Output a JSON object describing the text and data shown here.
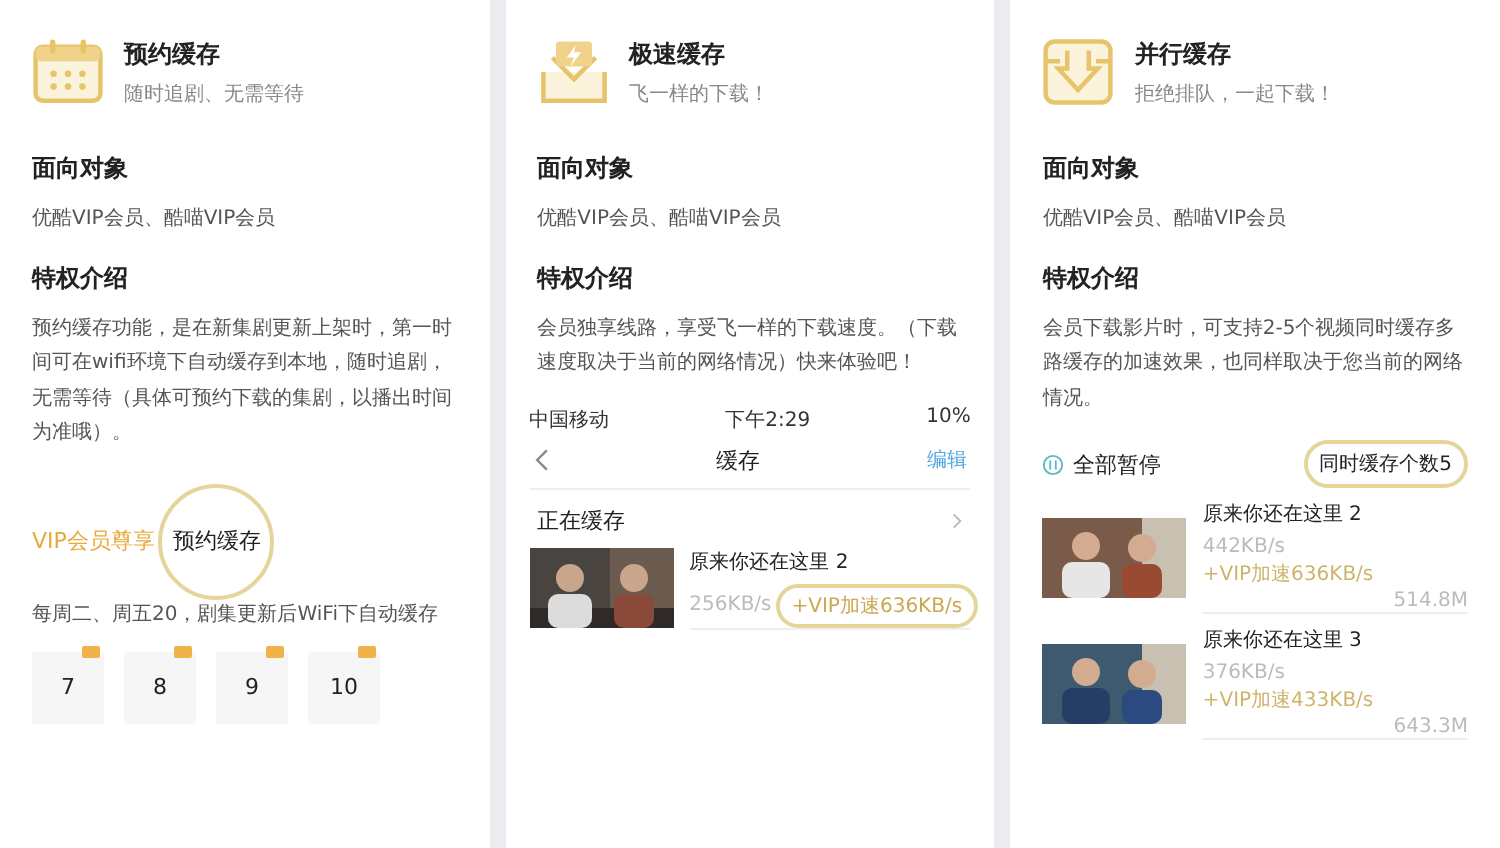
{
  "cards": [
    {
      "kind": "schedule",
      "title": "预约缓存",
      "subtitle": "随时追剧、无需等待",
      "audience_heading": "面向对象",
      "audience": "优酷VIP会员、酷喵VIP会员",
      "intro_heading": "特权介绍",
      "intro": "预约缓存功能，是在新集剧更新上架时，第一时间可在wifi环境下自动缓存到本地，随时追剧，无需等待（具体可预约下载的集剧，以播出时间为准哦）。",
      "demo": {
        "headline": "VIP会员尊享",
        "magnifier": "预约缓存",
        "schedule_start": "每周二、周五20",
        "schedule_end": "，剧集更新后WiFi下自动缓存",
        "episodes": [
          "7",
          "8",
          "9",
          "10"
        ]
      }
    },
    {
      "kind": "speed",
      "title": "极速缓存",
      "subtitle": "飞一样的下载！",
      "audience_heading": "面向对象",
      "audience": "优酷VIP会员、酷喵VIP会员",
      "intro_heading": "特权介绍",
      "intro": "会员独享线路，享受飞一样的下载速度。（下载速度取决于当前的网络情况）快来体验吧！",
      "demo": {
        "carrier": "中国移动",
        "time": "下午2:29",
        "battery": "10%",
        "nav_title": "缓存",
        "nav_action": "编辑",
        "section": "正在缓存",
        "item": {
          "title": "原来你还在这里 2",
          "speed": "256KB/s",
          "boost": "+VIP加速636KB/s"
        }
      }
    },
    {
      "kind": "parallel",
      "title": "并行缓存",
      "subtitle": "拒绝排队，一起下载！",
      "audience_heading": "面向对象",
      "audience": "优酷VIP会员、酷喵VIP会员",
      "intro_heading": "特权介绍",
      "intro": "会员下载影片时，可支持2-5个视频同时缓存多路缓存的加速效果，也同样取决于您当前的网络情况。",
      "demo": {
        "pause_all": "全部暂停",
        "concurrency": "同时缓存个数5",
        "items": [
          {
            "title": "原来你还在这里 2",
            "speed": "442KB/s",
            "boost": "+VIP加速636KB/s",
            "size": "514.8M"
          },
          {
            "title": "原来你还在这里 3",
            "speed": "376KB/s",
            "boost": "+VIP加速433KB/s",
            "size": "643.3M"
          }
        ]
      }
    }
  ]
}
